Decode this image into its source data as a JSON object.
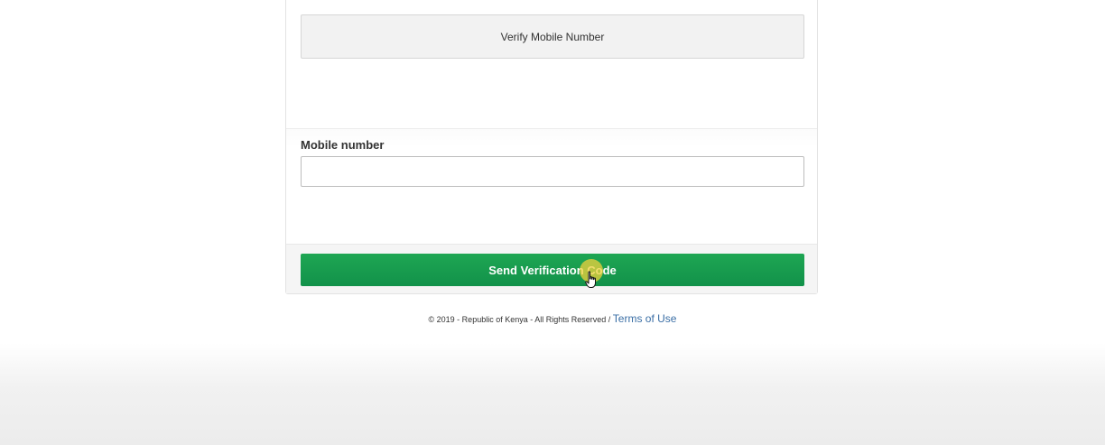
{
  "panel": {
    "verify_title": "Verify Mobile Number",
    "mobile_label": "Mobile number",
    "mobile_value": "",
    "mobile_placeholder": "",
    "send_button_label": "Send Verification Code"
  },
  "footer": {
    "copyright_text": "© 2019 - Republic of Kenya - All Rights Reserved /",
    "terms_link": "Terms of Use"
  },
  "colors": {
    "button_green": "#1a9d4f",
    "link_blue": "#3a6ea5",
    "cursor_highlight": "#f0d23c"
  },
  "icons": {
    "cursor": "hand-pointer-icon"
  }
}
